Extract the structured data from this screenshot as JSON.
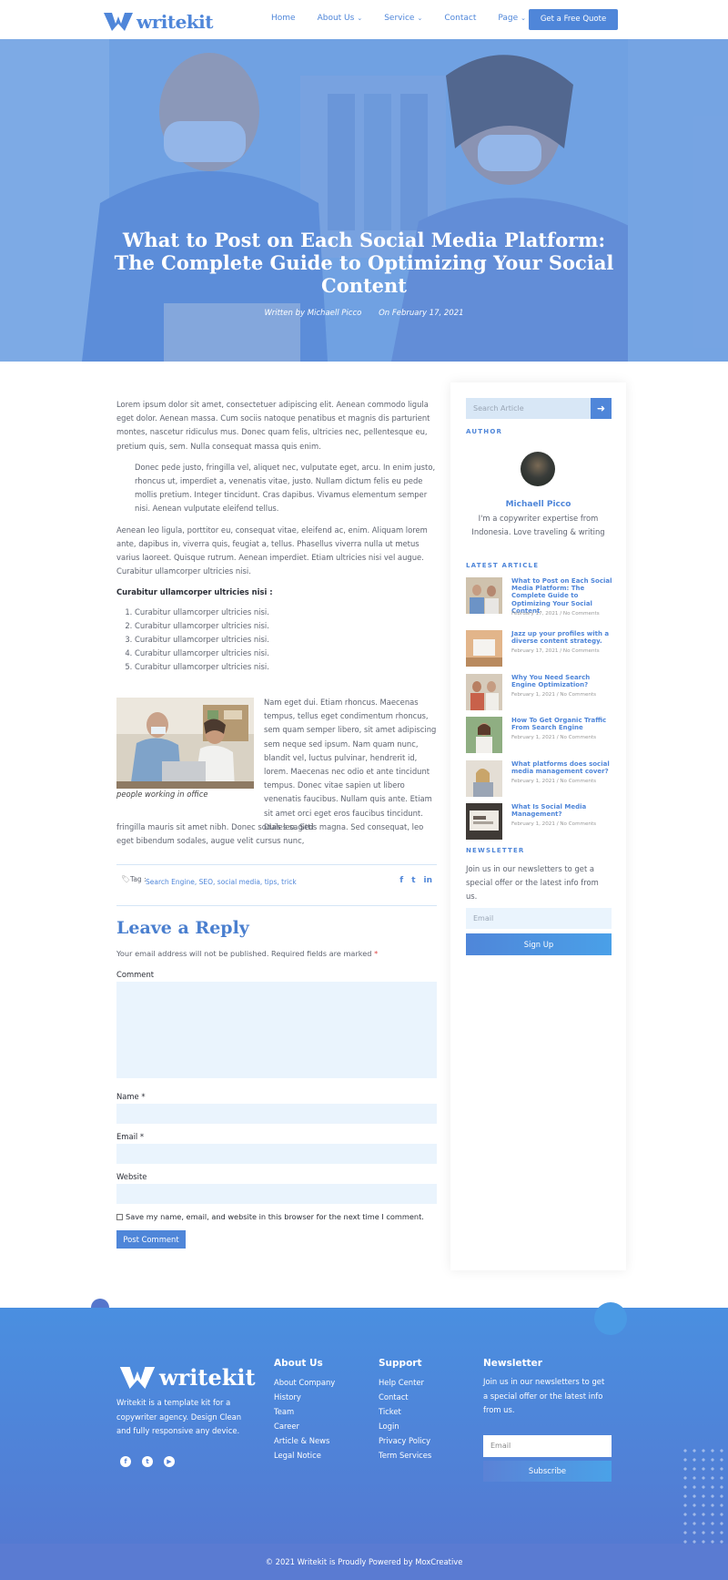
{
  "nav": {
    "logo_text": "writekit",
    "menu": [
      {
        "label": "Home",
        "has_dropdown": false
      },
      {
        "label": "About Us",
        "has_dropdown": true
      },
      {
        "label": "Service",
        "has_dropdown": true
      },
      {
        "label": "Contact",
        "has_dropdown": false
      },
      {
        "label": "Page",
        "has_dropdown": true
      }
    ],
    "cta_label": "Get a Free Quote"
  },
  "hero": {
    "title": "What to Post on Each Social Media Platform: The Complete Guide to Optimizing Your Social Content",
    "author": "Written by Michaell Picco",
    "date": "On February 17, 2021"
  },
  "article": {
    "p1": "Lorem ipsum dolor sit amet, consectetuer adipiscing elit. Aenean commodo ligula eget dolor. Aenean massa. Cum sociis natoque penatibus et magnis dis parturient montes, nascetur ridiculus mus. Donec quam felis, ultricies nec, pellentesque eu, pretium quis, sem. Nulla consequat massa quis enim.",
    "quote": "Donec pede justo, fringilla vel, aliquet nec, vulputate eget, arcu. In enim justo, rhoncus ut, imperdiet a, venenatis vitae, justo. Nullam dictum felis eu pede mollis pretium. Integer tincidunt. Cras dapibus. Vivamus elementum semper nisi. Aenean vulputate eleifend tellus.",
    "p2": "Aenean leo ligula, porttitor eu, consequat vitae, eleifend ac, enim. Aliquam lorem ante, dapibus in, viverra quis, feugiat a, tellus. Phasellus viverra nulla ut metus varius laoreet. Quisque rutrum. Aenean imperdiet. Etiam ultricies nisi vel augue. Curabitur ullamcorper ultricies nisi.",
    "subhead": "Curabitur ullamcorper ultricies nisi :",
    "list": [
      "Curabitur ullamcorper ultricies nisi.",
      "Curabitur ullamcorper ultricies nisi.",
      "Curabitur ullamcorper ultricies nisi.",
      "Curabitur ullamcorper ultricies nisi.",
      "Curabitur ullamcorper ultricies nisi."
    ],
    "image_caption": "people working in office",
    "wrap_text": "Nam eget dui. Etiam rhoncus. Maecenas tempus, tellus eget condimentum rhoncus, sem quam semper libero, sit amet adipiscing sem neque sed ipsum. Nam quam nunc, blandit vel, luctus pulvinar, hendrerit id, lorem. Maecenas nec odio et ante tincidunt tempus. Donec vitae sapien ut libero venenatis faucibus. Nullam quis ante. Etiam sit amet orci eget eros faucibus tincidunt. Duis leo. Sed",
    "wrap_tail": "fringilla mauris sit amet nibh. Donec sodales sagittis magna. Sed consequat, leo eget bibendum sodales, augue velit cursus nunc,",
    "tag_label": "Tag :",
    "tags": "Search Engine, SEO, social media, tips, trick"
  },
  "reply": {
    "title": "Leave a Reply",
    "note": "Your email address will not be published. Required fields are marked",
    "note_star": "*",
    "comment_label": "Comment",
    "name_label": "Name *",
    "email_label": "Email *",
    "website_label": "Website",
    "save_label": "Save my name, email, and website in this browser for the next time I comment.",
    "submit_label": "Post Comment"
  },
  "sidebar": {
    "search_placeholder": "Search Article",
    "author_heading": "AUTHOR",
    "author_name": "Michaell Picco",
    "author_bio": "I'm a copywriter expertise from Indonesia. Love traveling & writing",
    "latest_heading": "LATEST ARTICLE",
    "posts": [
      {
        "title": "What to Post on Each Social Media Platform: The Complete Guide to Optimizing Your Social Content",
        "meta": "February 17, 2021 / No Comments"
      },
      {
        "title": "Jazz up your profiles with a diverse content strategy.",
        "meta": "February 17, 2021 / No Comments"
      },
      {
        "title": "Why You Need Search Engine Optimization?",
        "meta": "February 1, 2021 / No Comments"
      },
      {
        "title": "How To Get Organic Traffic From Search Engine",
        "meta": "February 1, 2021 / No Comments"
      },
      {
        "title": "What platforms does social media management cover?",
        "meta": "February 1, 2021 / No Comments"
      },
      {
        "title": "What Is Social Media Management?",
        "meta": "February 1, 2021 / No Comments"
      }
    ],
    "newsletter_heading": "NEWSLETTER",
    "newsletter_text": "Join us in our newsletters to get a special offer or the latest info from us.",
    "email_placeholder": "Email",
    "signup_label": "Sign Up"
  },
  "footer": {
    "logo_text": "writekit",
    "description": "Writekit is a template kit for a copywriter agency. Design Clean and fully responsive any device.",
    "about_title": "About Us",
    "about_links": [
      "About Company",
      "History",
      "Team",
      "Career",
      "Article & News",
      "Legal Notice"
    ],
    "support_title": "Support",
    "support_links": [
      "Help Center",
      "Contact",
      "Ticket",
      "Login",
      "Privacy Policy",
      "Term Services"
    ],
    "newsletter_title": "Newsletter",
    "newsletter_text": "Join us in our newsletters to get a special offer or the latest info from us.",
    "email_placeholder": "Email",
    "subscribe_label": "Subscribe",
    "copyright": "© 2021 Writekit is Proudly Powered by MoxCreative"
  },
  "colors": {
    "accent": "#4f86d9",
    "footer_top": "#4a8fe0",
    "footer_bottom": "#5577d0",
    "field_bg": "#eaf4fd"
  }
}
